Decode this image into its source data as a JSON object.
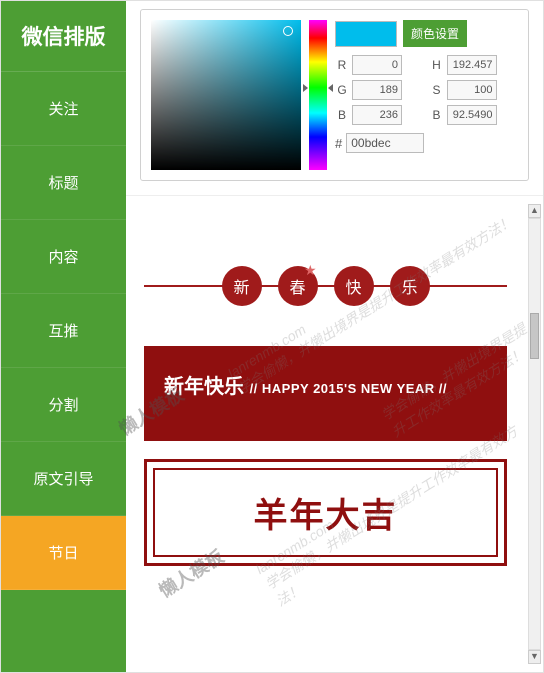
{
  "sidebar": {
    "title": "微信排版",
    "items": [
      {
        "label": "关注"
      },
      {
        "label": "标题"
      },
      {
        "label": "内容"
      },
      {
        "label": "互推"
      },
      {
        "label": "分割"
      },
      {
        "label": "原文引导"
      },
      {
        "label": "节日"
      }
    ],
    "active_index": 6
  },
  "color_picker": {
    "preview_hex": "#00bdec",
    "set_button": "颜色设置",
    "r": {
      "label": "R",
      "value": "0"
    },
    "g": {
      "label": "G",
      "value": "189"
    },
    "b": {
      "label": "B",
      "value": "236"
    },
    "h": {
      "label": "H",
      "value": "192.457"
    },
    "s": {
      "label": "S",
      "value": "100"
    },
    "br": {
      "label": "B",
      "value": "92.5490"
    },
    "hex_label": "#",
    "hex_value": "00bdec"
  },
  "templates": {
    "circles": [
      "新",
      "春",
      "快",
      "乐"
    ],
    "block1_title": "新年快乐",
    "block1_sub": "// HAPPY 2015'S NEW YEAR //",
    "block2_text": "羊年大吉"
  },
  "watermark": {
    "brand": "懒人模板",
    "domain": "lanrenmb.com",
    "slogan": "学会偷懒，并懒出境界是提升工作效率最有效方法！"
  },
  "scroll": {
    "up": "▲",
    "down": "▼"
  }
}
